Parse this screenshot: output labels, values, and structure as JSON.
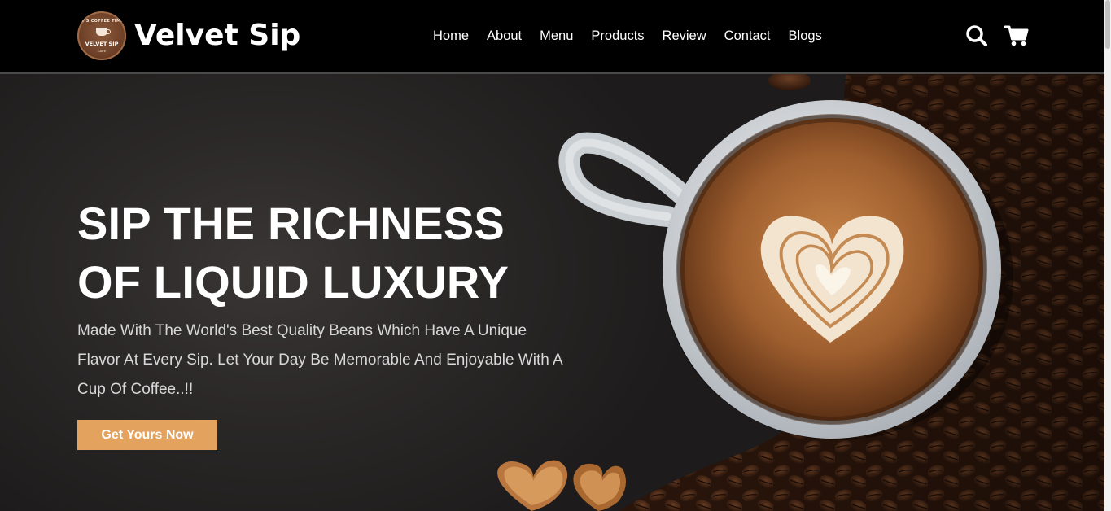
{
  "header": {
    "logo": {
      "ring_text": "IT'S COFFEE TIME",
      "name": "VELVET SIP",
      "sub": "CAFE"
    },
    "brand_name": "Velvet Sip",
    "nav": [
      "Home",
      "About",
      "Menu",
      "Products",
      "Review",
      "Contact",
      "Blogs"
    ],
    "icons": {
      "search": "search-icon",
      "cart": "cart-icon"
    }
  },
  "hero": {
    "title_line1": "SIP THE RICHNESS",
    "title_line2": "OF LIQUID LUXURY",
    "description": "Made With The World's Best Quality Beans Which Have A Unique Flavor At Every Sip. Let Your Day Be Memorable And Enjoyable With A Cup Of Coffee..!!",
    "cta_label": "Get Yours Now"
  },
  "colors": {
    "header_bg": "#000000",
    "accent": "#e3a35f",
    "hero_bg": "#2b2828",
    "text": "#ffffff",
    "muted_text": "#d8d8d8",
    "coffee": "#b9773f"
  }
}
